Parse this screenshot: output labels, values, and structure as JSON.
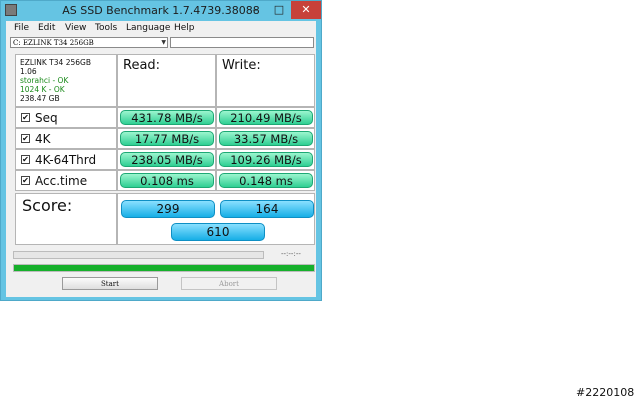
{
  "window": {
    "title": "AS SSD Benchmark 1.7.4739.38088",
    "close_label": "✕",
    "minimize_label": "–",
    "maximize_label": "□"
  },
  "menu": [
    "File",
    "Edit",
    "View",
    "Tools",
    "Language",
    "Help"
  ],
  "drive_select": {
    "value": "C: EZLINK T34 256GB"
  },
  "drive_info": {
    "name": "EZLINK T34 256GB",
    "firmware": "1.06",
    "driver": "storahci - OK",
    "alignment": "1024 K - OK",
    "size": "238.47 GB"
  },
  "headers": {
    "read": "Read:",
    "write": "Write:"
  },
  "rows": [
    {
      "label": "Seq",
      "read": "431.78 MB/s",
      "write": "210.49 MB/s",
      "checked": true
    },
    {
      "label": "4K",
      "read": "17.77 MB/s",
      "write": "33.57 MB/s",
      "checked": true
    },
    {
      "label": "4K-64Thrd",
      "read": "238.05 MB/s",
      "write": "109.26 MB/s",
      "checked": true
    },
    {
      "label": "Acc.time",
      "read": "0.108 ms",
      "write": "0.148 ms",
      "checked": true
    }
  ],
  "score": {
    "label": "Score:",
    "read": "299",
    "write": "164",
    "total": "610"
  },
  "progress": {
    "time_label": "--:--:--",
    "main_fraction": 0.0,
    "second_fraction": 1.0
  },
  "buttons": {
    "start": "Start",
    "abort": "Abort"
  },
  "watermark": "#2220108",
  "check_glyph": "✔"
}
